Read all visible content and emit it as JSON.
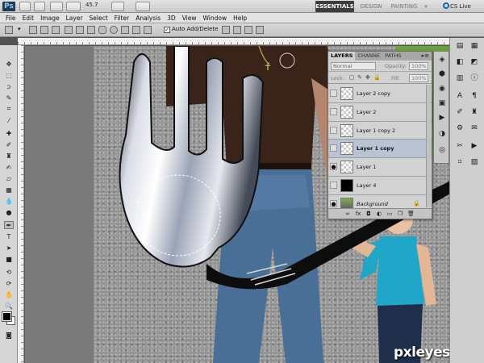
{
  "app": {
    "logo": "Ps",
    "zoom": "45.7",
    "workspaces": [
      "ESSENTIALS",
      "DESIGN",
      "PAINTING",
      "»"
    ],
    "cs_live": "CS Live"
  },
  "menu": [
    "File",
    "Edit",
    "Image",
    "Layer",
    "Select",
    "Filter",
    "Analysis",
    "3D",
    "View",
    "Window",
    "Help"
  ],
  "options": {
    "auto_add_delete": "Auto Add/Delete",
    "auto_add_delete_checked": true
  },
  "layers_panel": {
    "tabs": [
      "LAYERS",
      "CHANNE",
      "PATHS"
    ],
    "menu_glyph": "▸≡",
    "blend_mode": "Normal",
    "opacity_label": "Opacity:",
    "opacity_value": "100%",
    "lock_label": "Lock:",
    "fill_label": "Fill:",
    "fill_value": "100%",
    "layers": [
      {
        "name": "Layer 2 copy",
        "visible": false,
        "thumb": "transparent",
        "selected": false
      },
      {
        "name": "Layer 2",
        "visible": false,
        "thumb": "transparent",
        "selected": false
      },
      {
        "name": "Layer 1 copy 2",
        "visible": false,
        "thumb": "transparent",
        "selected": false
      },
      {
        "name": "Layer 1 copy",
        "visible": false,
        "thumb": "transparent",
        "selected": true
      },
      {
        "name": "Layer 1",
        "visible": true,
        "thumb": "transparent",
        "selected": false
      },
      {
        "name": "Layer 4",
        "visible": false,
        "thumb": "black",
        "selected": false
      },
      {
        "name": "Background",
        "visible": true,
        "thumb": "photo",
        "selected": false,
        "locked": true
      }
    ]
  },
  "watermark": "pxleyes.com",
  "colors": {
    "workspace_active": "#3d3d3d",
    "selected_layer": "#b9c3d3",
    "grass": "#5f9a30",
    "shirt_teal": "#1fa6c9",
    "jeans": "#4a6f97"
  }
}
